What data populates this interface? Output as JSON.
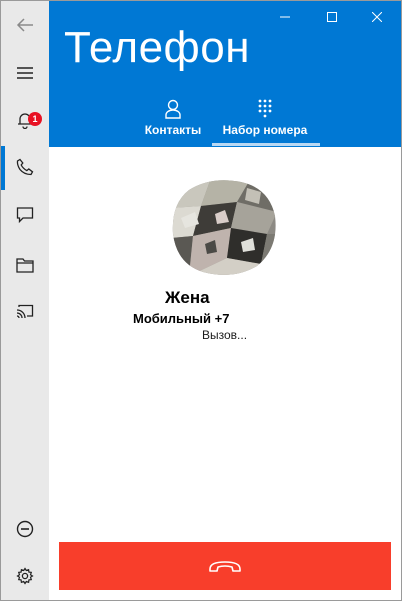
{
  "window": {
    "title": "Телефон",
    "controls": [
      "minimize-icon",
      "maximize-icon",
      "close-icon"
    ]
  },
  "rail": {
    "back_icon": "back-arrow-icon",
    "items": [
      {
        "icon": "hamburger-menu-icon"
      },
      {
        "icon": "bell-icon",
        "badge": "1"
      },
      {
        "icon": "phone-icon",
        "active": true
      },
      {
        "icon": "message-icon"
      },
      {
        "icon": "folder-icon"
      },
      {
        "icon": "cast-screen-icon"
      }
    ],
    "bottom_items": [
      {
        "icon": "minus-circle-icon"
      },
      {
        "icon": "gear-icon"
      }
    ]
  },
  "tabs": [
    {
      "label": "Контакты",
      "icon": "person-icon",
      "selected": false
    },
    {
      "label": "Набор номера",
      "icon": "dialpad-icon",
      "selected": true
    }
  ],
  "call": {
    "name": "Жена",
    "number": "Мобильный +7",
    "status": "Вызов..."
  },
  "hangup": {
    "icon": "hang-up-phone-icon"
  },
  "colors": {
    "accent": "#0078d4",
    "rail_bg": "#e9e9e9",
    "badge": "#e81123",
    "hangup": "#f83e2b"
  }
}
